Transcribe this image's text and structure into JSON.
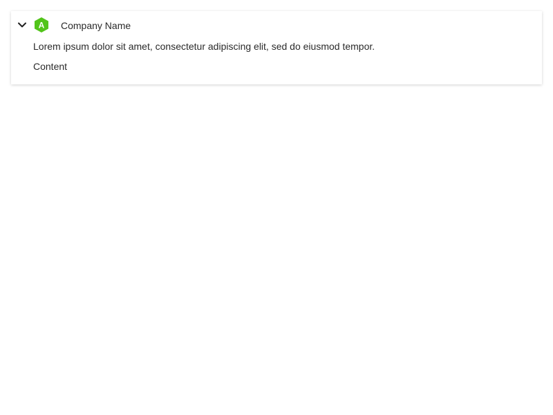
{
  "card": {
    "expanded": true,
    "logo": {
      "letter": "A",
      "color": "#52c41a",
      "icon": "hexagon-logo-icon"
    },
    "company_name": "Company Name",
    "description": "Lorem ipsum dolor sit amet, consectetur adipiscing elit, sed do eiusmod tempor.",
    "content": "Content",
    "toggle_icon": "chevron-down-icon"
  }
}
